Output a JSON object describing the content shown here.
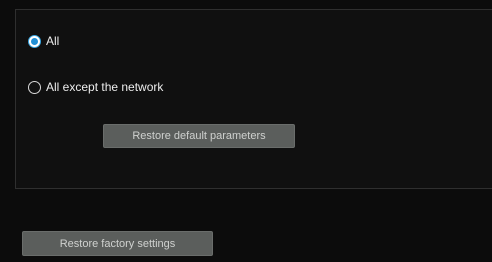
{
  "options": {
    "all_label": "All",
    "all_except_network_label": "All except the network",
    "selected": "All"
  },
  "buttons": {
    "restore_default_parameters": "Restore default parameters",
    "restore_factory_settings": "Restore factory settings"
  },
  "colors": {
    "background": "#0c0c0c",
    "button": "#5b5e5c",
    "radio_accent": "#1f8fd6"
  }
}
